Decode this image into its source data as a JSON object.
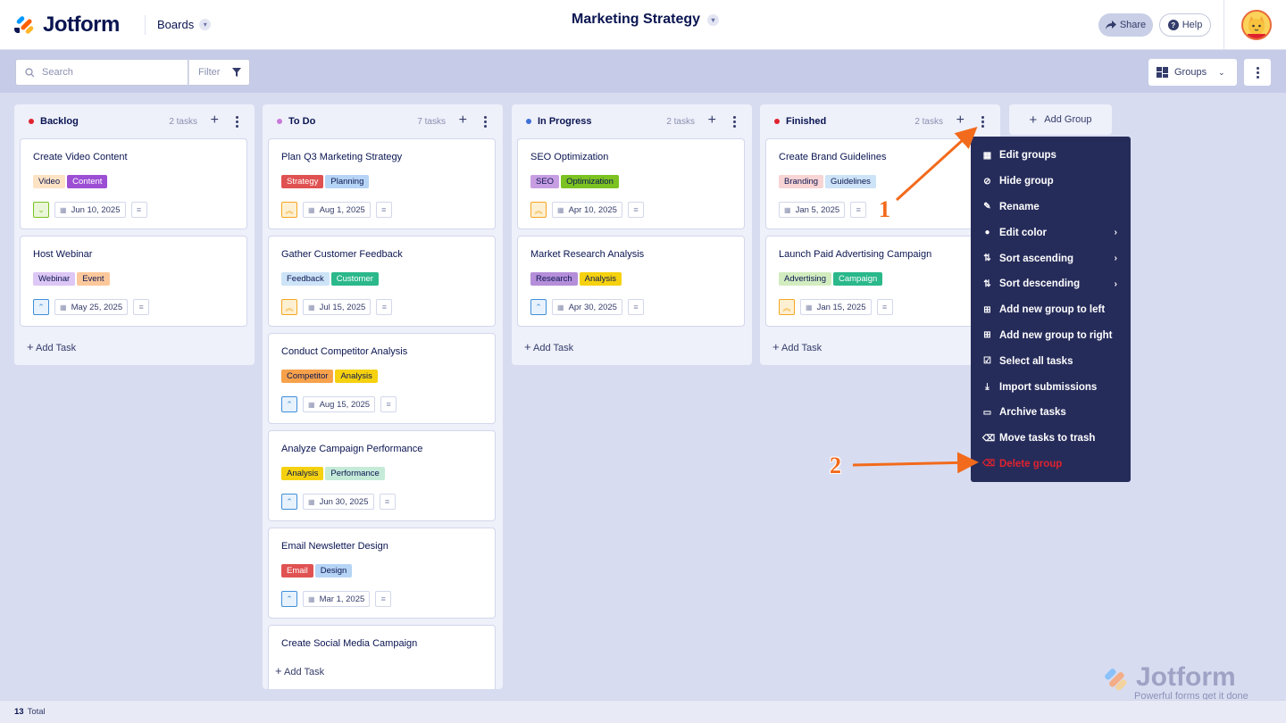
{
  "header": {
    "logo_text": "Jotform",
    "boards_label": "Boards",
    "page_title": "Marketing Strategy",
    "share_label": "Share",
    "help_label": "Help",
    "help_glyph": "?"
  },
  "toolbar": {
    "search_placeholder": "Search",
    "filter_label": "Filter",
    "groups_label": "Groups"
  },
  "columns": [
    {
      "title": "Backlog",
      "count": "2 tasks",
      "dot_color": "#e0222f",
      "add_task": "Add Task",
      "cards": [
        {
          "title": "Create Video Content",
          "tags": [
            {
              "label": "Video",
              "color": "#fde3c4"
            },
            {
              "label": "Content",
              "color": "#9c4ed4",
              "text": "#ffffff"
            }
          ],
          "priority": "down",
          "date": "Jun 10, 2025"
        },
        {
          "title": "Host Webinar",
          "tags": [
            {
              "label": "Webinar",
              "color": "#ddc7f5"
            },
            {
              "label": "Event",
              "color": "#fcc89b"
            }
          ],
          "priority": "up",
          "date": "May 25, 2025"
        }
      ]
    },
    {
      "title": "To Do",
      "count": "7 tasks",
      "dot_color": "#c77ad8",
      "add_task": "Add Task",
      "cards": [
        {
          "title": "Plan Q3 Marketing Strategy",
          "tags": [
            {
              "label": "Strategy",
              "color": "#e05252",
              "text": "#ffffff"
            },
            {
              "label": "Planning",
              "color": "#b6d4f5"
            }
          ],
          "priority": "double-up",
          "date": "Aug 1, 2025"
        },
        {
          "title": "Gather Customer Feedback",
          "tags": [
            {
              "label": "Feedback",
              "color": "#cde3f7"
            },
            {
              "label": "Customer",
              "color": "#2bb88a",
              "text": "#ffffff"
            }
          ],
          "priority": "double-up",
          "date": "Jul 15, 2025"
        },
        {
          "title": "Conduct Competitor Analysis",
          "tags": [
            {
              "label": "Competitor",
              "color": "#f7a24b"
            },
            {
              "label": "Analysis",
              "color": "#f5d10f"
            }
          ],
          "priority": "up",
          "date": "Aug 15, 2025"
        },
        {
          "title": "Analyze Campaign Performance",
          "tags": [
            {
              "label": "Analysis",
              "color": "#f5d10f"
            },
            {
              "label": "Performance",
              "color": "#c5ead8"
            }
          ],
          "priority": "up",
          "date": "Jun 30, 2025"
        },
        {
          "title": "Email Newsletter Design",
          "tags": [
            {
              "label": "Email",
              "color": "#e05252",
              "text": "#ffffff"
            },
            {
              "label": "Design",
              "color": "#b6d4f5"
            }
          ],
          "priority": "up",
          "date": "Mar 1, 2025"
        },
        {
          "title": "Create Social Media Campaign",
          "tags": [],
          "priority": "",
          "date": ""
        }
      ]
    },
    {
      "title": "In Progress",
      "count": "2 tasks",
      "dot_color": "#3f6fd8",
      "add_task": "Add Task",
      "cards": [
        {
          "title": "SEO Optimization",
          "tags": [
            {
              "label": "SEO",
              "color": "#c89ee3"
            },
            {
              "label": "Optimization",
              "color": "#7bc222"
            }
          ],
          "priority": "double-up",
          "date": "Apr 10, 2025"
        },
        {
          "title": "Market Research Analysis",
          "tags": [
            {
              "label": "Research",
              "color": "#b58ed9"
            },
            {
              "label": "Analysis",
              "color": "#f5d10f"
            }
          ],
          "priority": "up",
          "date": "Apr 30, 2025"
        }
      ]
    },
    {
      "title": "Finished",
      "count": "2 tasks",
      "dot_color": "#e0222f",
      "add_task": "Add Task",
      "cards": [
        {
          "title": "Create Brand Guidelines",
          "tags": [
            {
              "label": "Branding",
              "color": "#f8d4d4"
            },
            {
              "label": "Guidelines",
              "color": "#cde3f7"
            }
          ],
          "priority": "",
          "date": "Jan 5, 2025"
        },
        {
          "title": "Launch Paid Advertising Campaign",
          "tags": [
            {
              "label": "Advertising",
              "color": "#d2ecc0"
            },
            {
              "label": "Campaign",
              "color": "#2bb88a",
              "text": "#ffffff"
            }
          ],
          "priority": "double-up",
          "date": "Jan 15, 2025"
        }
      ]
    }
  ],
  "add_group_label": "Add Group",
  "context_menu": {
    "items": [
      {
        "label": "Edit groups",
        "icon": "grid-icon",
        "submenu": false
      },
      {
        "label": "Hide group",
        "icon": "eye-off-icon",
        "submenu": false
      },
      {
        "label": "Rename",
        "icon": "edit-icon",
        "submenu": false
      },
      {
        "label": "Edit color",
        "icon": "droplet-icon",
        "submenu": true
      },
      {
        "label": "Sort ascending",
        "icon": "sort-asc-icon",
        "submenu": true
      },
      {
        "label": "Sort descending",
        "icon": "sort-desc-icon",
        "submenu": true
      },
      {
        "label": "Add new group to left",
        "icon": "add-left-icon",
        "submenu": false
      },
      {
        "label": "Add new group to right",
        "icon": "add-right-icon",
        "submenu": false
      },
      {
        "label": "Select all tasks",
        "icon": "checkbox-icon",
        "submenu": false
      },
      {
        "label": "Import submissions",
        "icon": "import-icon",
        "submenu": false
      },
      {
        "label": "Archive tasks",
        "icon": "archive-icon",
        "submenu": false
      },
      {
        "label": "Move tasks to trash",
        "icon": "trash-icon",
        "submenu": false
      },
      {
        "label": "Delete group",
        "icon": "trash-red-icon",
        "submenu": false,
        "danger": true
      }
    ]
  },
  "footer": {
    "count": "13",
    "label": "Total"
  },
  "watermark": {
    "text": "Jotform",
    "tagline": "Powerful forms get it done"
  },
  "annotations": {
    "one": "1",
    "two": "2"
  },
  "colors": {
    "accent": "#f26a1b",
    "menu_bg": "#262c5a",
    "danger": "#e0222f"
  }
}
